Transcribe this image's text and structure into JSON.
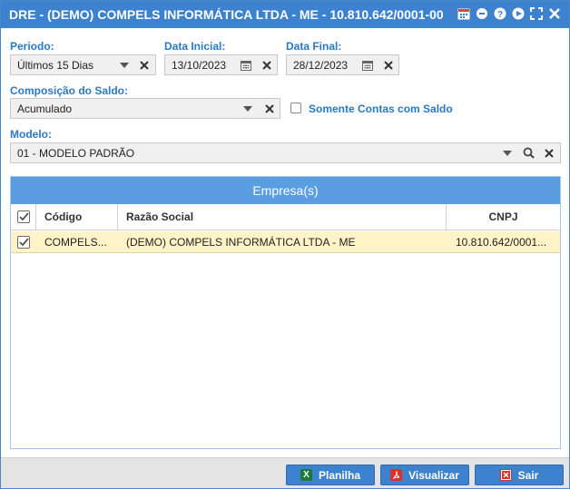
{
  "window": {
    "title": "DRE - (DEMO) COMPELS INFORMÁTICA LTDA - ME - 10.810.642/0001-00",
    "icons": [
      "calendar-icon",
      "minimize-icon",
      "help-icon",
      "play-icon",
      "maximize-icon",
      "close-icon"
    ]
  },
  "filters": {
    "periodo_label": "Periodo:",
    "periodo_value": "Últimos 15 Dias",
    "data_inicial_label": "Data Inicial:",
    "data_inicial_value": "13/10/2023",
    "data_final_label": "Data Final:",
    "data_final_value": "28/12/2023",
    "composicao_label": "Composição do Saldo:",
    "composicao_value": "Acumulado",
    "somente_contas_label": "Somente Contas com Saldo",
    "somente_contas_checked": false,
    "modelo_label": "Modelo:",
    "modelo_value": "01 - MODELO PADRÃO"
  },
  "grid": {
    "title": "Empresa(s)",
    "columns": [
      "Código",
      "Razão Social",
      "CNPJ"
    ],
    "rows": [
      {
        "checked": true,
        "codigo": "COMPELS...",
        "razao_social": "(DEMO) COMPELS INFORMÁTICA LTDA - ME",
        "cnpj": "10.810.642/0001..."
      }
    ]
  },
  "footer": {
    "planilha_label": "Planilha",
    "visualizar_label": "Visualizar",
    "sair_label": "Sair"
  },
  "colors": {
    "accent": "#3c82cf",
    "label_blue": "#2a79c4",
    "grid_header": "#5a9de0",
    "selected_row": "#fff3c8"
  }
}
